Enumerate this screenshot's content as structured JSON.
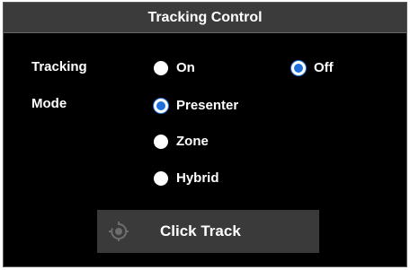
{
  "window": {
    "title": "Tracking Control"
  },
  "tracking": {
    "label": "Tracking",
    "options": [
      {
        "label": "On",
        "selected": false
      },
      {
        "label": "Off",
        "selected": true
      }
    ]
  },
  "mode": {
    "label": "Mode",
    "options": [
      {
        "label": "Presenter",
        "selected": true
      },
      {
        "label": "Zone",
        "selected": false
      },
      {
        "label": "Hybrid",
        "selected": false
      }
    ]
  },
  "click_track": {
    "label": "Click Track",
    "icon": "crosshair-target-icon",
    "enabled": false
  },
  "colors": {
    "panel_bg": "#000000",
    "title_bg": "#3b3b3b",
    "selected_radio": "#1e6fd9",
    "button_bg": "#3a3a3a",
    "icon_disabled": "#6d6d6d"
  }
}
